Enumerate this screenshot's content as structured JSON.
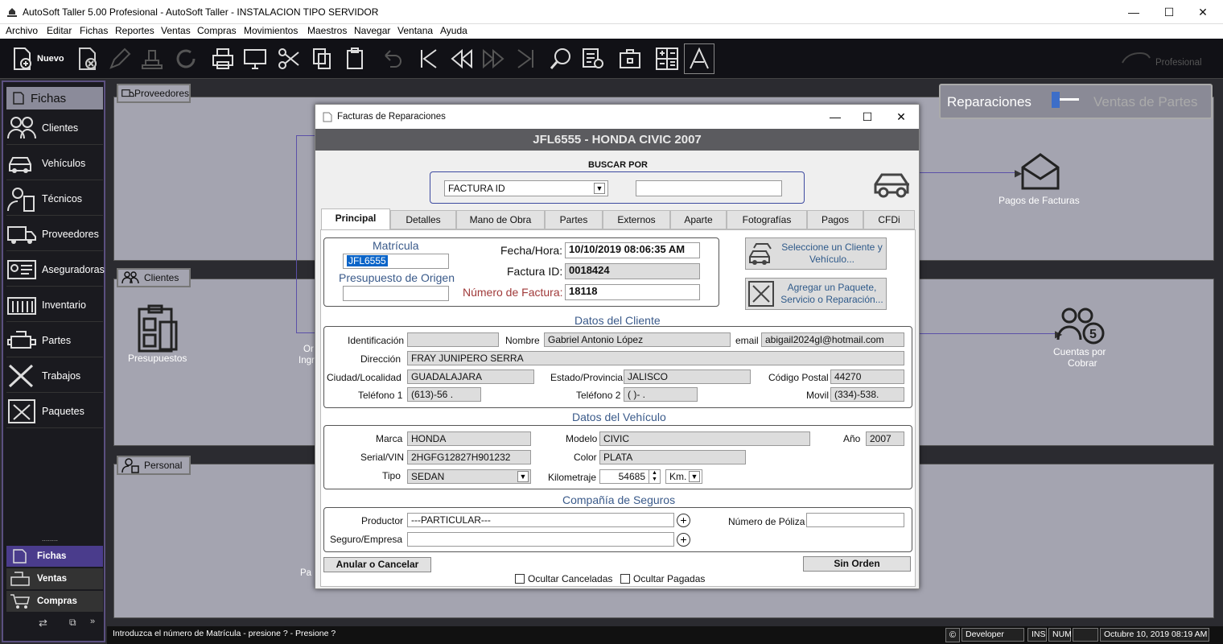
{
  "window": {
    "title": "AutoSoft Taller 5.00 Profesional - AutoSoft Taller - INSTALACION TIPO SERVIDOR",
    "min": "—",
    "max": "☐",
    "close": "✕"
  },
  "menu": [
    "Archivo",
    "Editar",
    "Fichas",
    "Reportes",
    "Ventas",
    "Compras",
    "Movimientos",
    "Maestros",
    "Navegar",
    "Ventana",
    "Ayuda"
  ],
  "toolbar": {
    "new_label": "Nuevo",
    "brand": "Profesional"
  },
  "sidebar": {
    "header": "Fichas",
    "items": [
      "Clientes",
      "Vehículos",
      "Técnicos",
      "Proveedores",
      "Aseguradoras",
      "Inventario",
      "Partes",
      "Trabajos",
      "Paquetes"
    ],
    "bottom_tabs": [
      "Fichas",
      "Ventas",
      "Compras"
    ],
    "dots": "........"
  },
  "desk": {
    "proveedores": "Proveedores",
    "clientes": "Clientes",
    "personal": "Personal",
    "presupuestos": "Presupuestos",
    "pagos": "Pagos de Facturas",
    "cuentas1": "Cuentas por",
    "cuentas2": "Cobrar",
    "switch_left": "Reparaciones",
    "switch_right": "Ventas de Partes",
    "frag1": "Or",
    "frag2": "Ingr",
    "frag3": "Pa"
  },
  "dialog": {
    "title": "Facturas de Reparaciones",
    "min": "—",
    "max": "☐",
    "close": "✕",
    "header": "JFL6555 - HONDA CIVIC 2007",
    "buscar": {
      "label": "BUSCAR POR",
      "option": "FACTURA ID",
      "value": ""
    },
    "tabs": [
      "Principal",
      "Detalles",
      "Mano de Obra",
      "Partes",
      "Externos",
      "Aparte",
      "Fotografías",
      "Pagos",
      "CFDi"
    ],
    "principal": {
      "matricula_label": "Matrícula",
      "matricula": "JFL6555",
      "presupuesto_label": "Presupuesto de Origen",
      "presupuesto": "",
      "fecha_label": "Fecha/Hora:",
      "fecha": "10/10/2019 08:06:35 AM",
      "factura_id_label": "Factura ID:",
      "factura_id": "0018424",
      "numero_label": "Número de Factura:",
      "numero": "18118"
    },
    "buttons": {
      "cliente1": "Seleccione un Cliente y",
      "cliente2": "Vehículo...",
      "paquete1": "Agregar un Paquete,",
      "paquete2": "Servicio o Reparación...",
      "anular": "Anular o Cancelar",
      "sin_orden": "Sin Orden"
    },
    "cliente": {
      "section": "Datos del Cliente",
      "id_label": "Identificación",
      "id": "",
      "nombre_label": "Nombre",
      "nombre": "Gabriel Antonio López",
      "email_label": "email",
      "email": "abigail2024gl@hotmail.com",
      "direccion_label": "Dirección",
      "direccion": "FRAY JUNIPERO SERRA",
      "ciudad_label": "Ciudad/Localidad",
      "ciudad": "GUADALAJARA",
      "estado_label": "Estado/Provincia",
      "estado": "JALISCO",
      "cp_label": "Código Postal",
      "cp": "44270",
      "tel1_label": "Teléfono 1",
      "tel1": "(613)-56 .",
      "tel2_label": "Teléfono 2",
      "tel2": "(  )-  .",
      "movil_label": "Movil",
      "movil": "(334)-538."
    },
    "vehiculo": {
      "section": "Datos del Vehículo",
      "marca_label": "Marca",
      "marca": "HONDA",
      "modelo_label": "Modelo",
      "modelo": "CIVIC",
      "anio_label": "Año",
      "anio": "2007",
      "serial_label": "Serial/VIN",
      "serial": "2HGFG12827H901232",
      "color_label": "Color",
      "color": "PLATA",
      "tipo_label": "Tipo",
      "tipo": "SEDAN",
      "km_label": "Kilometraje",
      "km": "54685",
      "km_unit": "Km."
    },
    "seguros": {
      "section": "Compañía de Seguros",
      "productor_label": "Productor",
      "productor": "---PARTICULAR---",
      "seguro_label": "Seguro/Empresa",
      "seguro": "",
      "poliza_label": "Número de Póliza",
      "poliza": ""
    },
    "checks": {
      "canceladas": "Ocultar Canceladas",
      "pagadas": "Ocultar Pagadas"
    }
  },
  "status": {
    "hint": "Introduzca el número de Matrícula - presione ? - Presione ?",
    "user": "Developer",
    "ins": "INS",
    "num": "NUM",
    "date": "Octubre 10, 2019 08:19 AM"
  }
}
